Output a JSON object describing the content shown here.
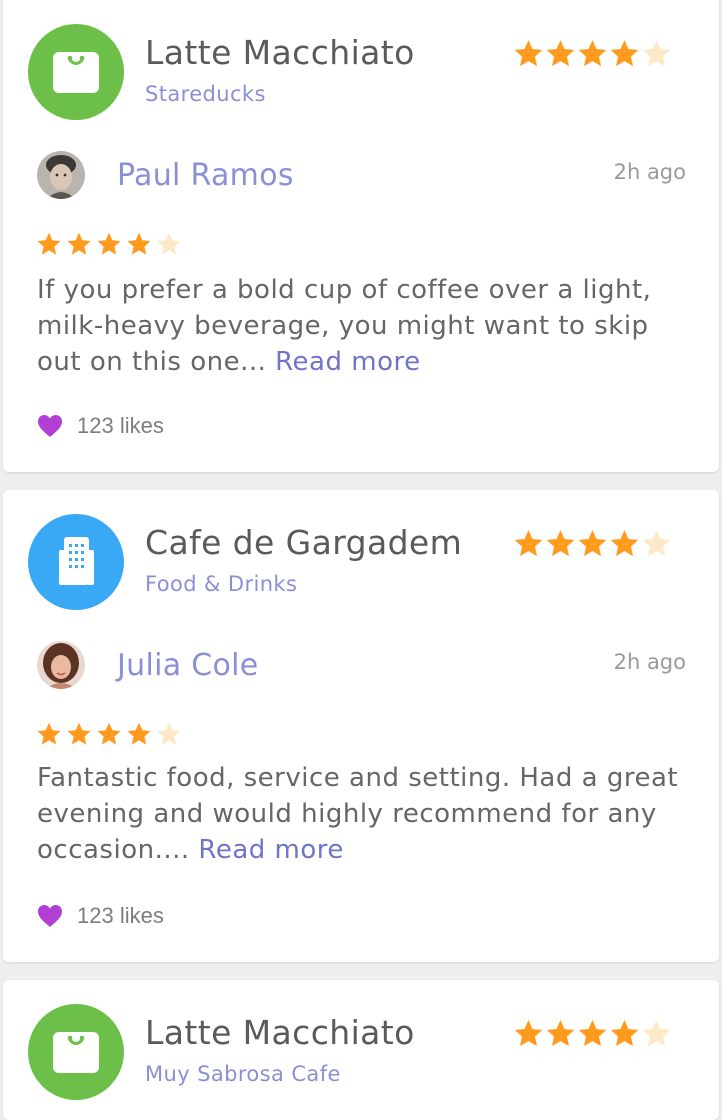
{
  "colors": {
    "accent": "#8b8fd6",
    "star": "#ff9a1f",
    "star_empty": "#fde8c8",
    "heart": "#b23fd4",
    "green_icon": "#6cc04a",
    "blue_icon": "#3aa9f5"
  },
  "cards": [
    {
      "place_name": "Latte Macchiato",
      "place_subtitle": "Stareducks",
      "place_icon": "shopping-bag-icon",
      "place_rating": 4,
      "reviewer_name": "Paul Ramos",
      "time": "2h ago",
      "review_rating": 4,
      "review_text": "If you prefer a bold cup of coffee over a light, milk-heavy beverage, you might want to skip out on this one...",
      "read_more": "Read more",
      "likes": "123 likes"
    },
    {
      "place_name": "Cafe de Gargadem",
      "place_subtitle": "Food & Drinks",
      "place_icon": "building-icon",
      "place_rating": 4,
      "reviewer_name": "Julia Cole",
      "time": "2h ago",
      "review_rating": 4,
      "review_text": "Fantastic food, service and setting. Had a great evening and would highly recommend for any occasion....",
      "read_more": "Read more",
      "likes": "123 likes"
    },
    {
      "place_name": "Latte Macchiato",
      "place_subtitle": "Muy Sabrosa Cafe",
      "place_icon": "shopping-bag-icon",
      "place_rating": 4
    }
  ]
}
